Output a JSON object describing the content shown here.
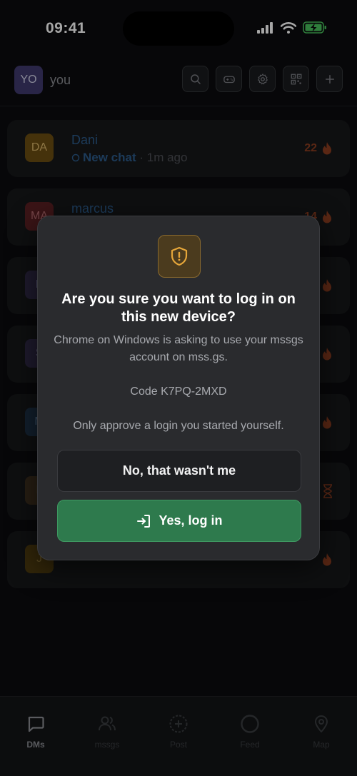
{
  "status_bar": {
    "time": "09:41"
  },
  "header": {
    "avatar_initials": "YO",
    "username": "you"
  },
  "chats": [
    {
      "initials": "DA",
      "name": "Dani",
      "status": "New chat",
      "time": " · 1m ago",
      "streak": "22",
      "avatar_color": "#6b4e12"
    },
    {
      "initials": "MA",
      "name": "marcus",
      "status": "",
      "time": "",
      "streak": "14",
      "avatar_color": "#5a1f22"
    },
    {
      "initials": "P",
      "name": "",
      "status": "",
      "time": "",
      "streak": "",
      "avatar_color": "#2e2845"
    },
    {
      "initials": "S",
      "name": "",
      "status": "",
      "time": "",
      "streak": "",
      "avatar_color": "#2e2845"
    },
    {
      "initials": "M",
      "name": "",
      "status": "",
      "time": "",
      "streak": "",
      "avatar_color": "#1c3046"
    },
    {
      "initials": "L",
      "name": "",
      "status": "",
      "time": "",
      "streak": "",
      "avatar_color": "#3d2e1e"
    },
    {
      "initials": "J",
      "name": "",
      "status": "",
      "time": "",
      "streak": "",
      "avatar_color": "#4d3b0e"
    }
  ],
  "modal": {
    "title": "Are you sure you want to log in on this new device?",
    "description": "Chrome on Windows is asking to use your mssgs account on mss.gs.",
    "code": "Code K7PQ-2MXD",
    "warning": "Only approve a login you started yourself.",
    "deny_label": "No, that wasn't me",
    "approve_label": "Yes, log in"
  },
  "tabs": [
    {
      "label": "DMs",
      "icon": "chat-bubble-icon",
      "active": true
    },
    {
      "label": "mssgs",
      "icon": "users-icon",
      "active": false
    },
    {
      "label": "Post",
      "icon": "plus-circle-icon",
      "active": false
    },
    {
      "label": "Feed",
      "icon": "circle-icon",
      "active": false
    },
    {
      "label": "Map",
      "icon": "map-pin-icon",
      "active": false
    }
  ],
  "colors": {
    "accent_green": "#2e7a4d",
    "warning_amber": "#e5a63a",
    "streak_orange": "#e0572a"
  }
}
